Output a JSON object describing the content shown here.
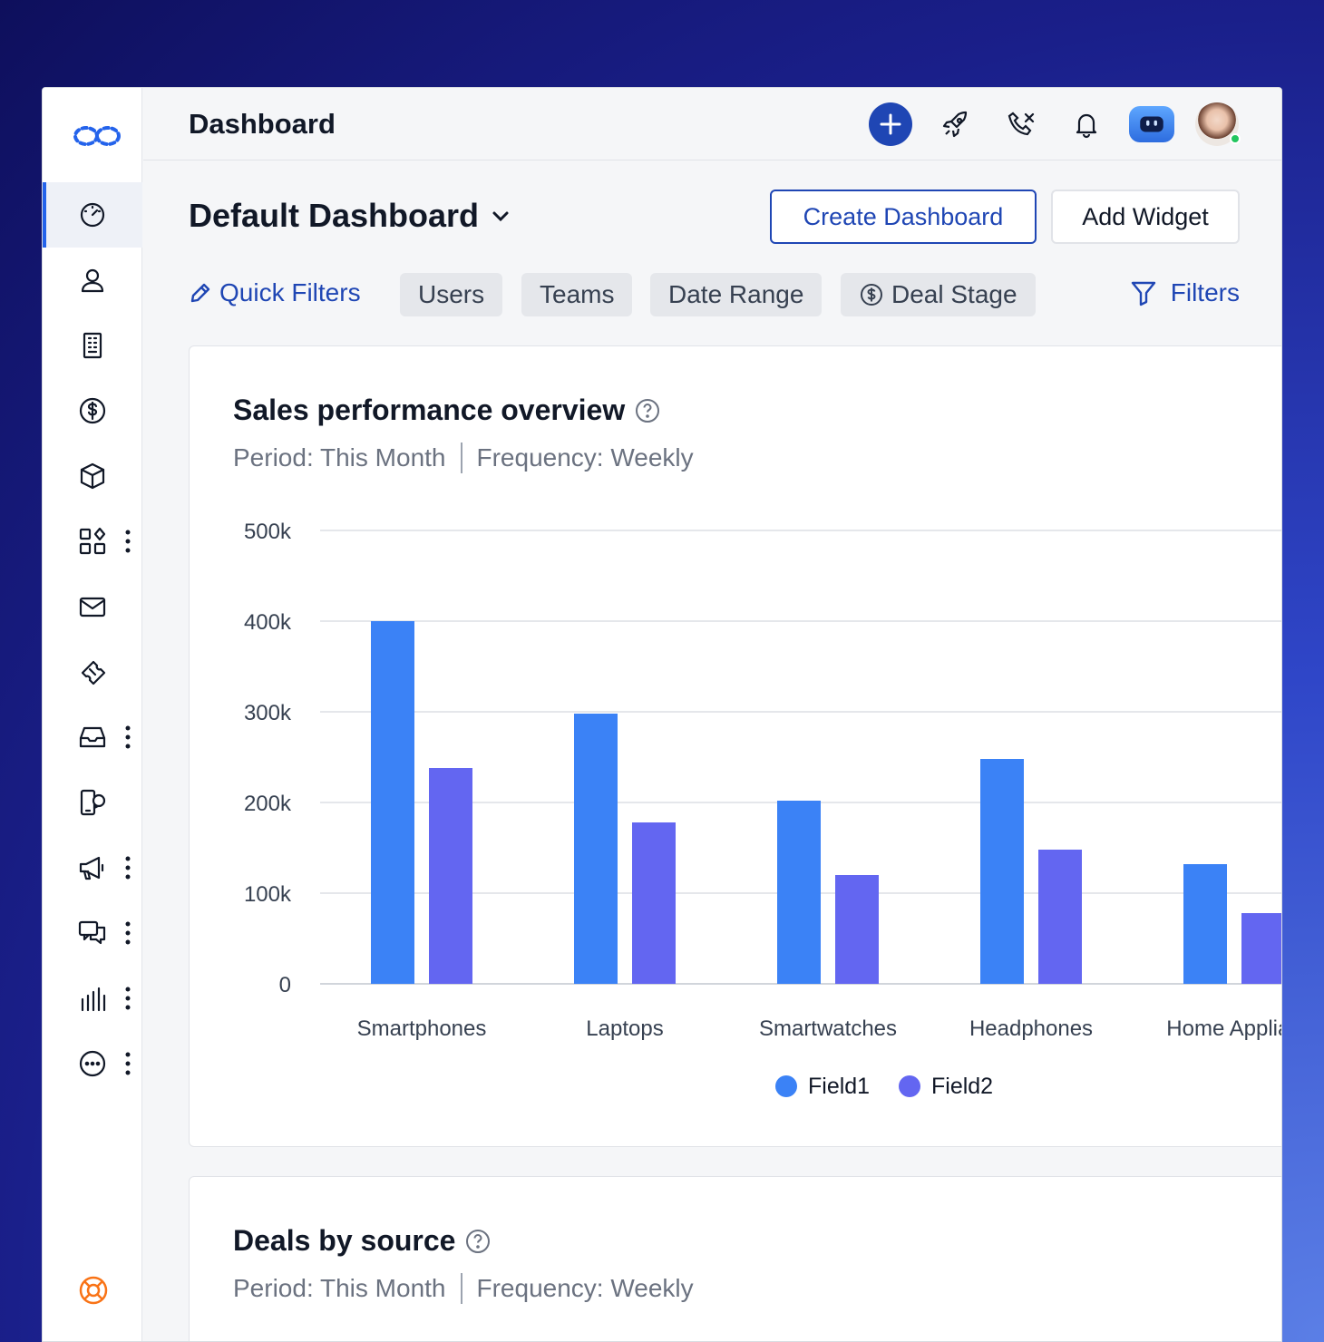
{
  "topbar": {
    "title": "Dashboard"
  },
  "sidebar": {
    "items": [
      {
        "icon": "speedometer-icon",
        "active": true
      },
      {
        "icon": "user-icon"
      },
      {
        "icon": "building-icon"
      },
      {
        "icon": "dollar-icon"
      },
      {
        "icon": "cube-icon"
      },
      {
        "icon": "apps-icon",
        "more": true
      },
      {
        "icon": "mail-icon"
      },
      {
        "icon": "ticket-icon"
      },
      {
        "icon": "inbox-icon",
        "more": true
      },
      {
        "icon": "phone-chat-icon"
      },
      {
        "icon": "megaphone-icon",
        "more": true
      },
      {
        "icon": "chat-icon",
        "more": true
      },
      {
        "icon": "bar-chart-icon",
        "more": true
      },
      {
        "icon": "more-circle-icon",
        "more": true
      }
    ],
    "help_icon": "lifebuoy-icon"
  },
  "header": {
    "dashboard_name": "Default Dashboard",
    "create_label": "Create Dashboard",
    "add_widget_label": "Add Widget"
  },
  "filters": {
    "quick_filters_label": "Quick Filters",
    "chips": [
      "Users",
      "Teams",
      "Date Range",
      "Deal Stage"
    ],
    "filters_label": "Filters"
  },
  "cards": [
    {
      "title": "Sales performance overview",
      "period": "Period: This Month",
      "frequency": "Frequency: Weekly"
    },
    {
      "title": "Deals by source",
      "period": "Period: This Month",
      "frequency": "Frequency: Weekly"
    }
  ],
  "colors": {
    "accent": "#1f46b4",
    "field1": "#3b82f6",
    "field2": "#6366f1"
  },
  "chart_data": {
    "type": "bar",
    "categories": [
      "Smartphones",
      "Laptops",
      "Smartwatches",
      "Headphones",
      "Home Applian"
    ],
    "series": [
      {
        "name": "Field1",
        "values": [
          400000,
          298000,
          202000,
          248000,
          132000
        ]
      },
      {
        "name": "Field2",
        "values": [
          238000,
          178000,
          120000,
          148000,
          78000
        ]
      }
    ],
    "yticks": [
      "0",
      "100k",
      "200k",
      "300k",
      "400k",
      "500k"
    ],
    "ylim": [
      0,
      500000
    ],
    "grid": true,
    "legend": "bottom-center"
  }
}
